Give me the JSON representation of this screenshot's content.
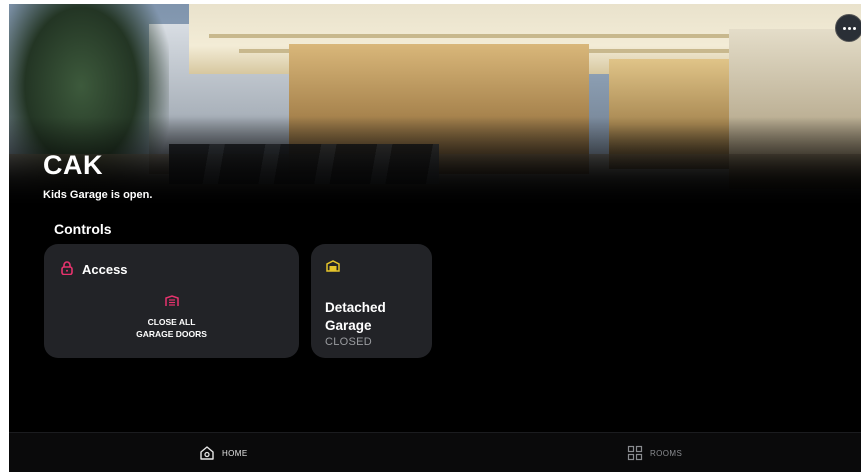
{
  "home": {
    "title": "CAK",
    "status": "Kids Garage is open."
  },
  "controls": {
    "heading": "Controls",
    "access_card": {
      "label": "Access",
      "action_label": "CLOSE ALL\nGARAGE DOORS",
      "icon": "lock-icon",
      "accent": "#e8336e"
    },
    "garage_card": {
      "name": "Detached Garage",
      "state": "CLOSED",
      "icon": "garage-door-icon",
      "accent": "#e5c42b"
    }
  },
  "nav": {
    "home_label": "HOME",
    "rooms_label": "ROOMS"
  }
}
